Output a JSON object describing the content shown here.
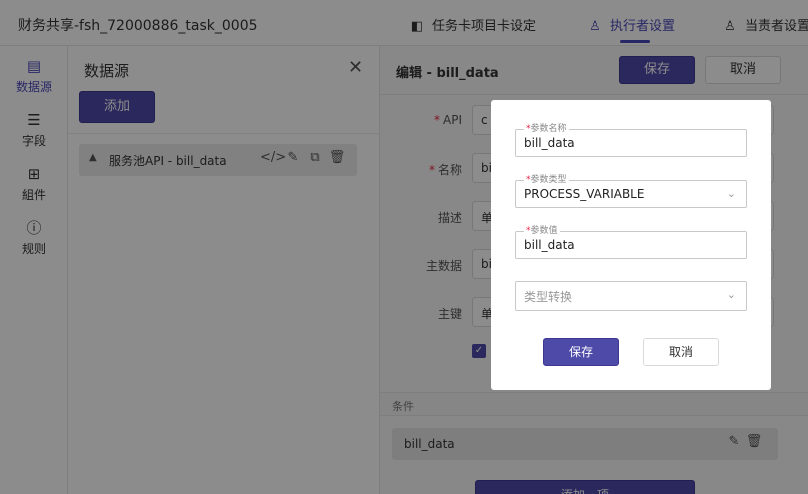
{
  "app": {
    "title": "财务共享-fsh_72000886_task_0005"
  },
  "tabs": [
    {
      "label": "任务卡项目卡设定",
      "icon": "layers-icon",
      "glyph": "◧",
      "active": false
    },
    {
      "label": "执行者设置",
      "icon": "person-tree-icon",
      "glyph": "♙",
      "active": true
    },
    {
      "label": "当责者设置",
      "icon": "person-icon",
      "glyph": "♙",
      "active": false
    }
  ],
  "leftnav": [
    {
      "label": "数据源",
      "icon": "database-icon",
      "glyph": "▤",
      "active": true
    },
    {
      "label": "字段",
      "icon": "list-icon",
      "glyph": "☰",
      "active": false
    },
    {
      "label": "組件",
      "icon": "grid-icon",
      "glyph": "⊞",
      "active": false
    },
    {
      "label": "规则",
      "icon": "alert-circle-icon",
      "glyph": "ⓘ",
      "active": false
    }
  ],
  "datasource": {
    "title": "数据源",
    "close_glyph": "✕",
    "add_label": "添加",
    "item": {
      "label": "服务池API - bill_data",
      "caret": "▲",
      "actions": [
        "</>",
        "✎",
        "⧉",
        "🗑"
      ]
    }
  },
  "editor": {
    "title": "编辑 - bill_data",
    "save_label": "保存",
    "cancel_label": "取消",
    "fields": [
      {
        "label": "API",
        "required": true,
        "value": "c"
      },
      {
        "label": "名称",
        "required": true,
        "value": "bi"
      },
      {
        "label": "描述",
        "required": false,
        "value": "单"
      },
      {
        "label": "主数据",
        "required": false,
        "value": "bi"
      },
      {
        "label": "主键",
        "required": false,
        "value": "单"
      }
    ],
    "check_glyph": "✓",
    "conditions_label": "条件",
    "condition_item": {
      "label": "bill_data",
      "actions": [
        "✎",
        "🗑"
      ]
    },
    "add_condition_label": "添加一项"
  },
  "modal": {
    "req_mark": "*",
    "fields": [
      {
        "label": "参数名称",
        "required": true,
        "value": "bill_data",
        "type": "input"
      },
      {
        "label": "参数类型",
        "required": true,
        "value": "PROCESS_VARIABLE",
        "type": "select"
      },
      {
        "label": "参数值",
        "required": true,
        "value": "bill_data",
        "type": "input"
      },
      {
        "label": "",
        "required": false,
        "value": "类型转换",
        "type": "select",
        "placeholder": true
      }
    ],
    "chevron": "⌄",
    "save_label": "保存",
    "cancel_label": "取消"
  }
}
